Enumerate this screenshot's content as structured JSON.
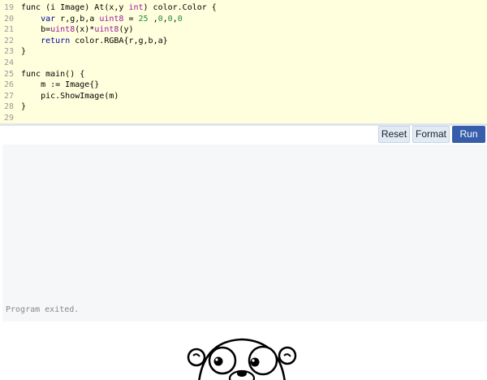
{
  "editor": {
    "lines": [
      {
        "num": "19",
        "tokens": [
          [
            "",
            "func (i Image) At(x,y "
          ],
          [
            "ty",
            "int"
          ],
          [
            "",
            ") color.Color {"
          ]
        ]
      },
      {
        "num": "20",
        "tokens": [
          [
            "",
            "    "
          ],
          [
            "kw",
            "var"
          ],
          [
            "",
            " r,g,b,a "
          ],
          [
            "ty",
            "uint8"
          ],
          [
            "",
            " = "
          ],
          [
            "nm",
            "25"
          ],
          [
            "",
            " ,"
          ],
          [
            "nm",
            "0"
          ],
          [
            "",
            ","
          ],
          [
            "nm",
            "0"
          ],
          [
            "",
            ","
          ],
          [
            "nm",
            "0"
          ]
        ]
      },
      {
        "num": "21",
        "tokens": [
          [
            "",
            "    b="
          ],
          [
            "ty",
            "uint8"
          ],
          [
            "",
            "(x)*"
          ],
          [
            "ty",
            "uint8"
          ],
          [
            "",
            "(y)"
          ]
        ]
      },
      {
        "num": "22",
        "tokens": [
          [
            "",
            "    "
          ],
          [
            "kw",
            "return"
          ],
          [
            "",
            " color.RGBA{r,g,b,a}"
          ]
        ]
      },
      {
        "num": "23",
        "tokens": [
          [
            "",
            "}"
          ]
        ]
      },
      {
        "num": "24",
        "tokens": []
      },
      {
        "num": "25",
        "tokens": [
          [
            "",
            "func main() {"
          ]
        ]
      },
      {
        "num": "26",
        "tokens": [
          [
            "",
            "    m := Image{}"
          ]
        ]
      },
      {
        "num": "27",
        "tokens": [
          [
            "",
            "    pic.ShowImage(m)"
          ]
        ]
      },
      {
        "num": "28",
        "tokens": [
          [
            "",
            "}"
          ]
        ]
      },
      {
        "num": "29",
        "tokens": []
      }
    ]
  },
  "toolbar": {
    "reset_label": "Reset",
    "format_label": "Format",
    "run_label": "Run"
  },
  "output": {
    "status": "Program exited."
  },
  "image": {
    "icon": "gopher-mascot"
  },
  "colors": {
    "editor_bg": "#ffffdd",
    "run_button": "#375eab",
    "secondary_button": "#e0ebf5",
    "output_bg": "#f6f7f8"
  }
}
